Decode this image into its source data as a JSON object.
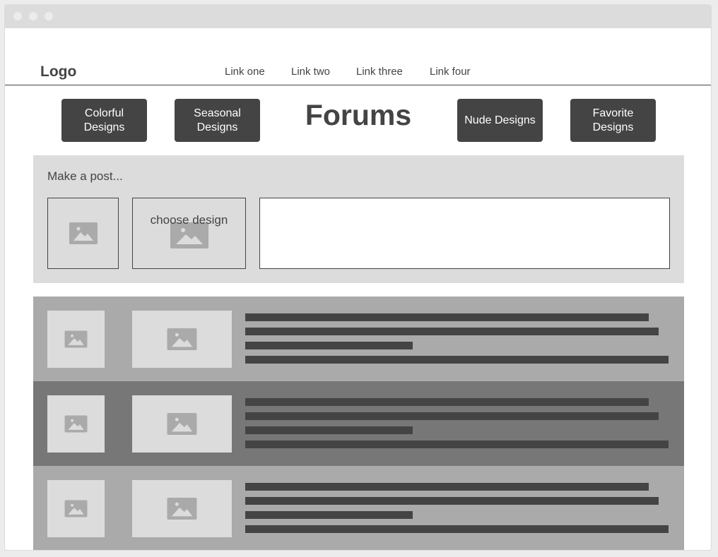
{
  "header": {
    "logo": "Logo",
    "nav": [
      "Link one",
      "Link two",
      "Link three",
      "Link four"
    ]
  },
  "categories": {
    "colorful": "Colorful Designs",
    "seasonal": "Seasonal Designs",
    "nude": "Nude Designs",
    "favorite": "Favorite Designs"
  },
  "page_title": "Forums",
  "composer": {
    "prompt": "Make a post...",
    "choose_design": "choose design",
    "text_value": ""
  },
  "feed": {
    "rows": [
      {
        "shade": "#aaaaaa"
      },
      {
        "shade": "#777777"
      },
      {
        "shade": "#aaaaaa"
      }
    ]
  },
  "colors": {
    "dark": "#444444",
    "placeholder": "#dcdcdc",
    "icon": "#aaaaaa"
  }
}
